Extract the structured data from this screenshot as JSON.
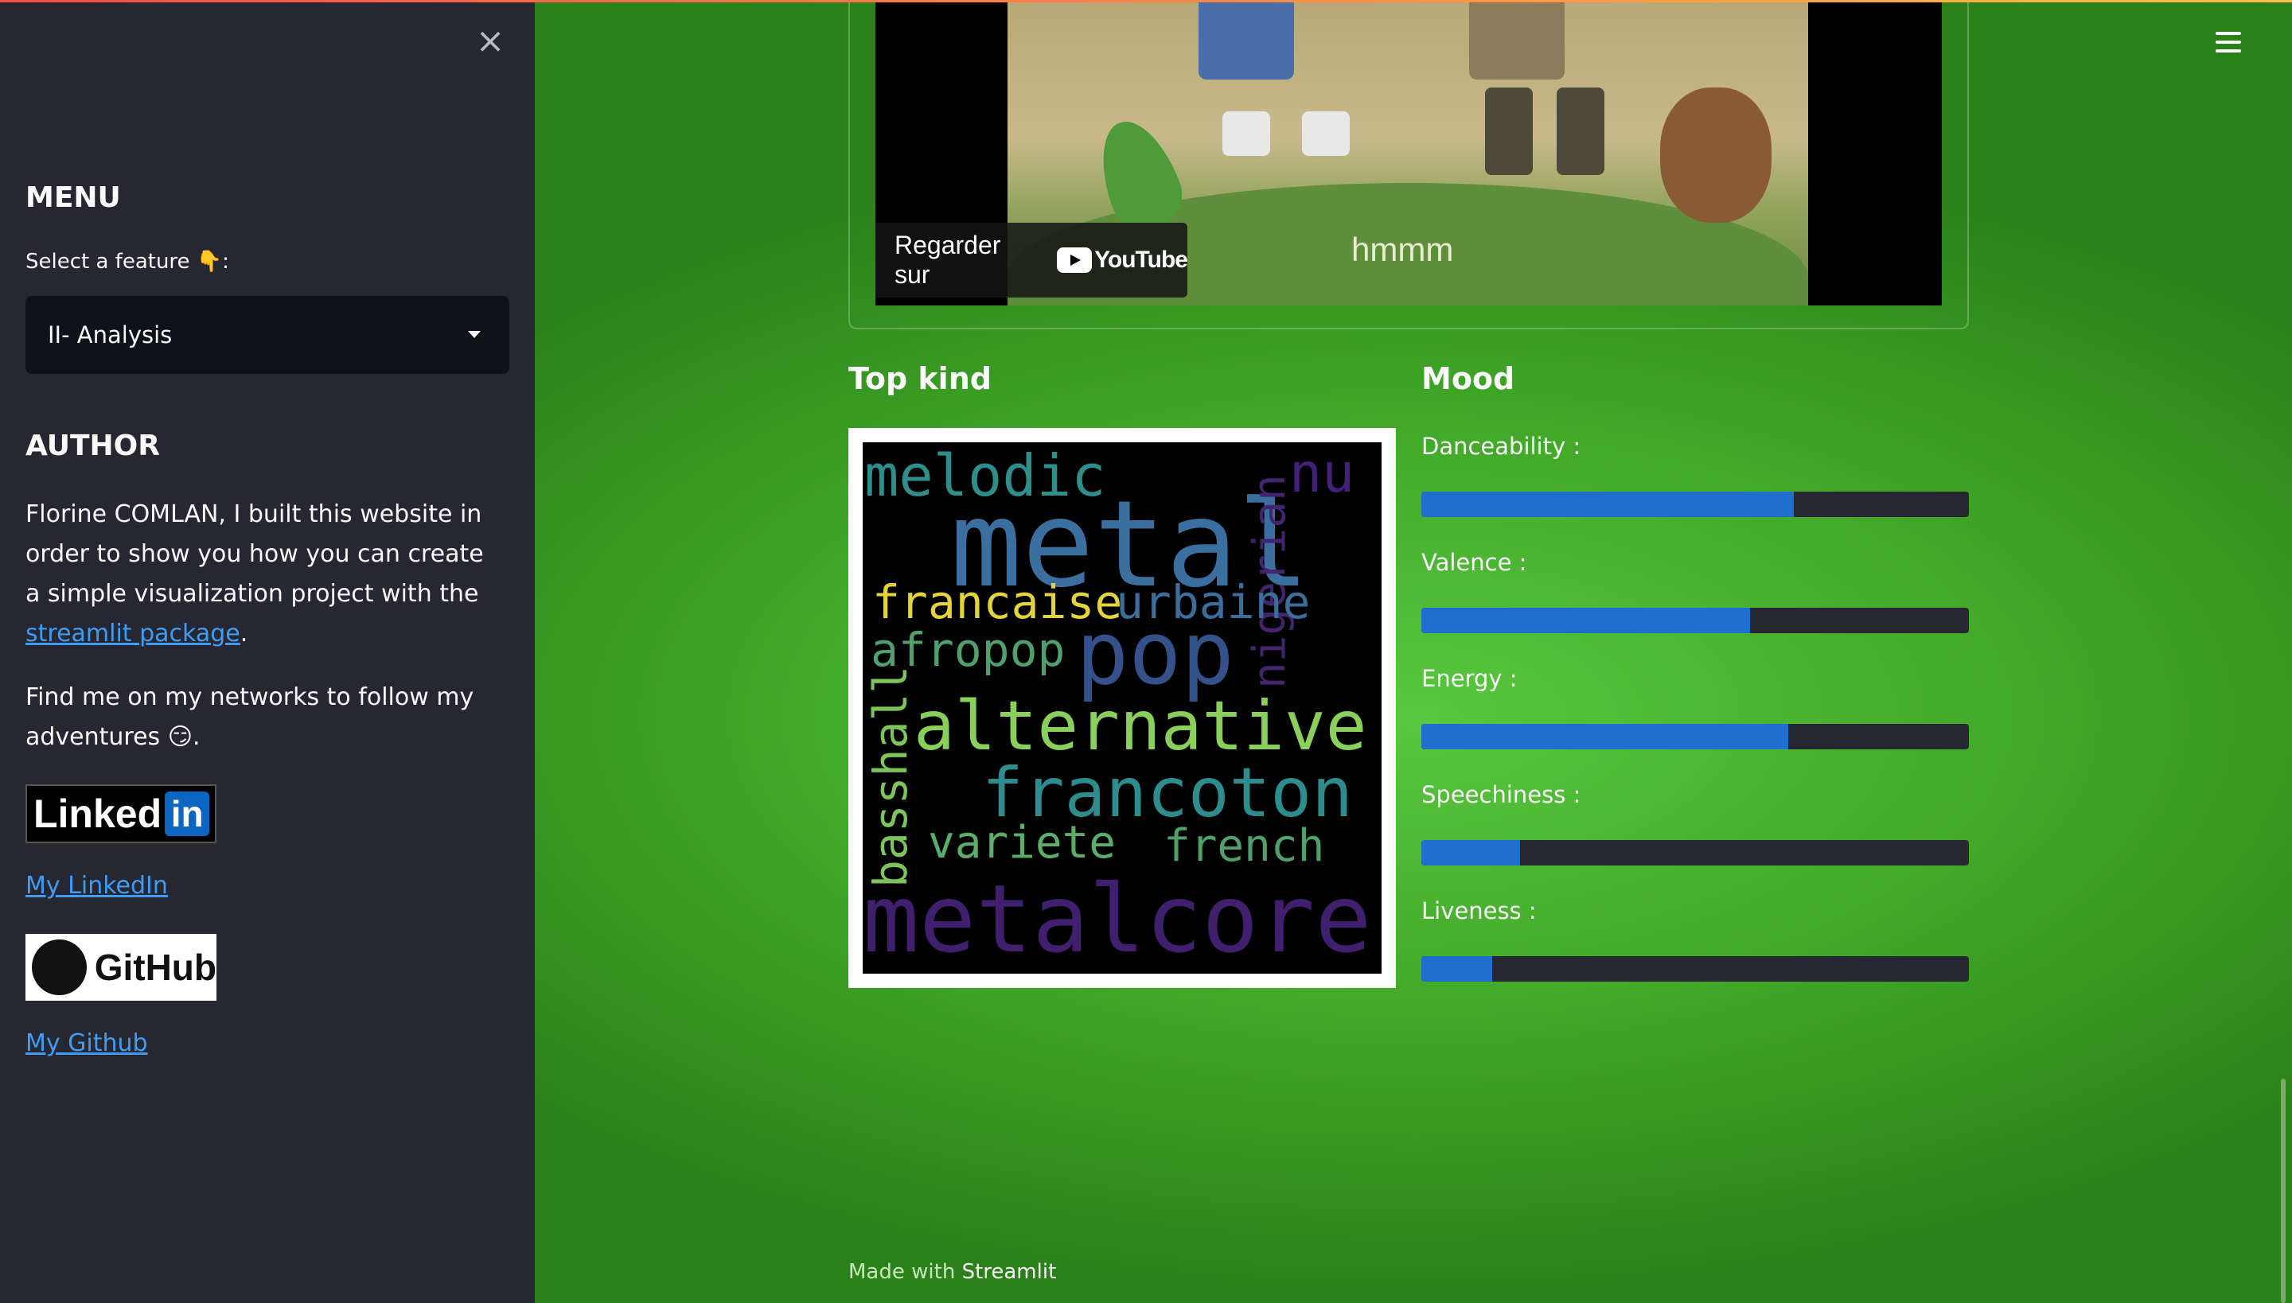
{
  "sidebar": {
    "menu_title": "MENU",
    "select_label": "Select a feature 👇:",
    "select_value": "II- Analysis",
    "author_title": "AUTHOR",
    "author_text_1": "Florine COMLAN, I built this website in order to show you how you can create a simple visualization project with the ",
    "author_link": "streamlit package",
    "author_text_end": ".",
    "networks_text": "Find me on my networks to follow my adventures 😏.",
    "linkedin_badge_word": "Linked",
    "linkedin_badge_in": "in",
    "linkedin_link": "My LinkedIn",
    "github_badge_word": "GitHub",
    "github_link": "My Github",
    "close_icon": "close-icon"
  },
  "video": {
    "watch_on": "Regarder sur",
    "youtube": "YouTube",
    "thumbnail_caption": "hmmm"
  },
  "top_kind": {
    "title": "Top kind",
    "words": [
      "melodic",
      "nu",
      "metal",
      "nigerian",
      "francaise",
      "urbaine",
      "afropop",
      "pop",
      "basshall",
      "alternative",
      "francoton",
      "variete",
      "french",
      "metalcore"
    ]
  },
  "mood": {
    "title": "Mood",
    "bars": [
      {
        "label": "Danceability :",
        "value": 0.68
      },
      {
        "label": "Valence :",
        "value": 0.6
      },
      {
        "label": "Energy :",
        "value": 0.67
      },
      {
        "label": "Speechiness :",
        "value": 0.18
      },
      {
        "label": "Liveness :",
        "value": 0.13
      }
    ],
    "bar_color": "#1f6fd1"
  },
  "footer": {
    "made_with": "Made with",
    "brand": "Streamlit"
  },
  "menu_icon": "hamburger-icon"
}
